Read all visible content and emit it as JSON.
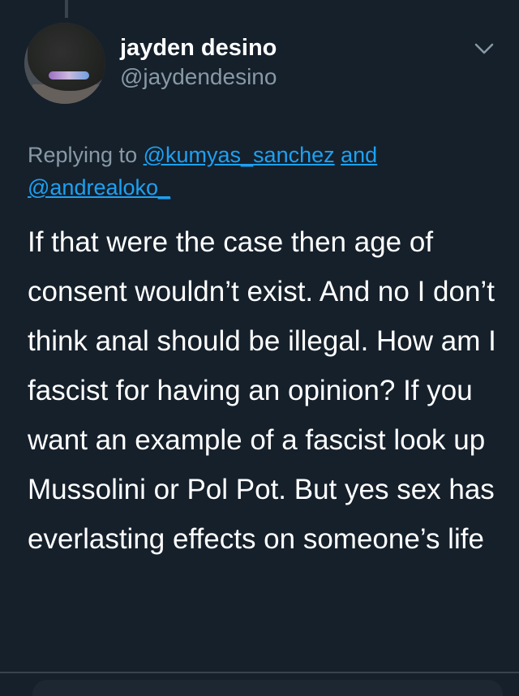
{
  "tweet": {
    "display_name": "jayden desino",
    "handle": "@jaydendesino",
    "replying_prefix": "Replying to",
    "mention_1": "@kumyas_sanchez",
    "mention_joiner": "and",
    "mention_2": "@andrealoko_",
    "body": "If that were the case then age of consent wouldn’t exist. And no I don’t think anal should be illegal. How am I fascist for having an opinion? If you want an example of a fascist look up Mussolini or Pol Pot. But yes sex has everlasting effects on someone’s life"
  },
  "icons": {
    "menu": "chevron-down-icon",
    "avatar": "avatar"
  },
  "colors": {
    "background": "#15202b",
    "primary_text": "#ffffff",
    "secondary_text": "#8899a6",
    "link": "#1da1f2",
    "divider": "#38444d"
  }
}
